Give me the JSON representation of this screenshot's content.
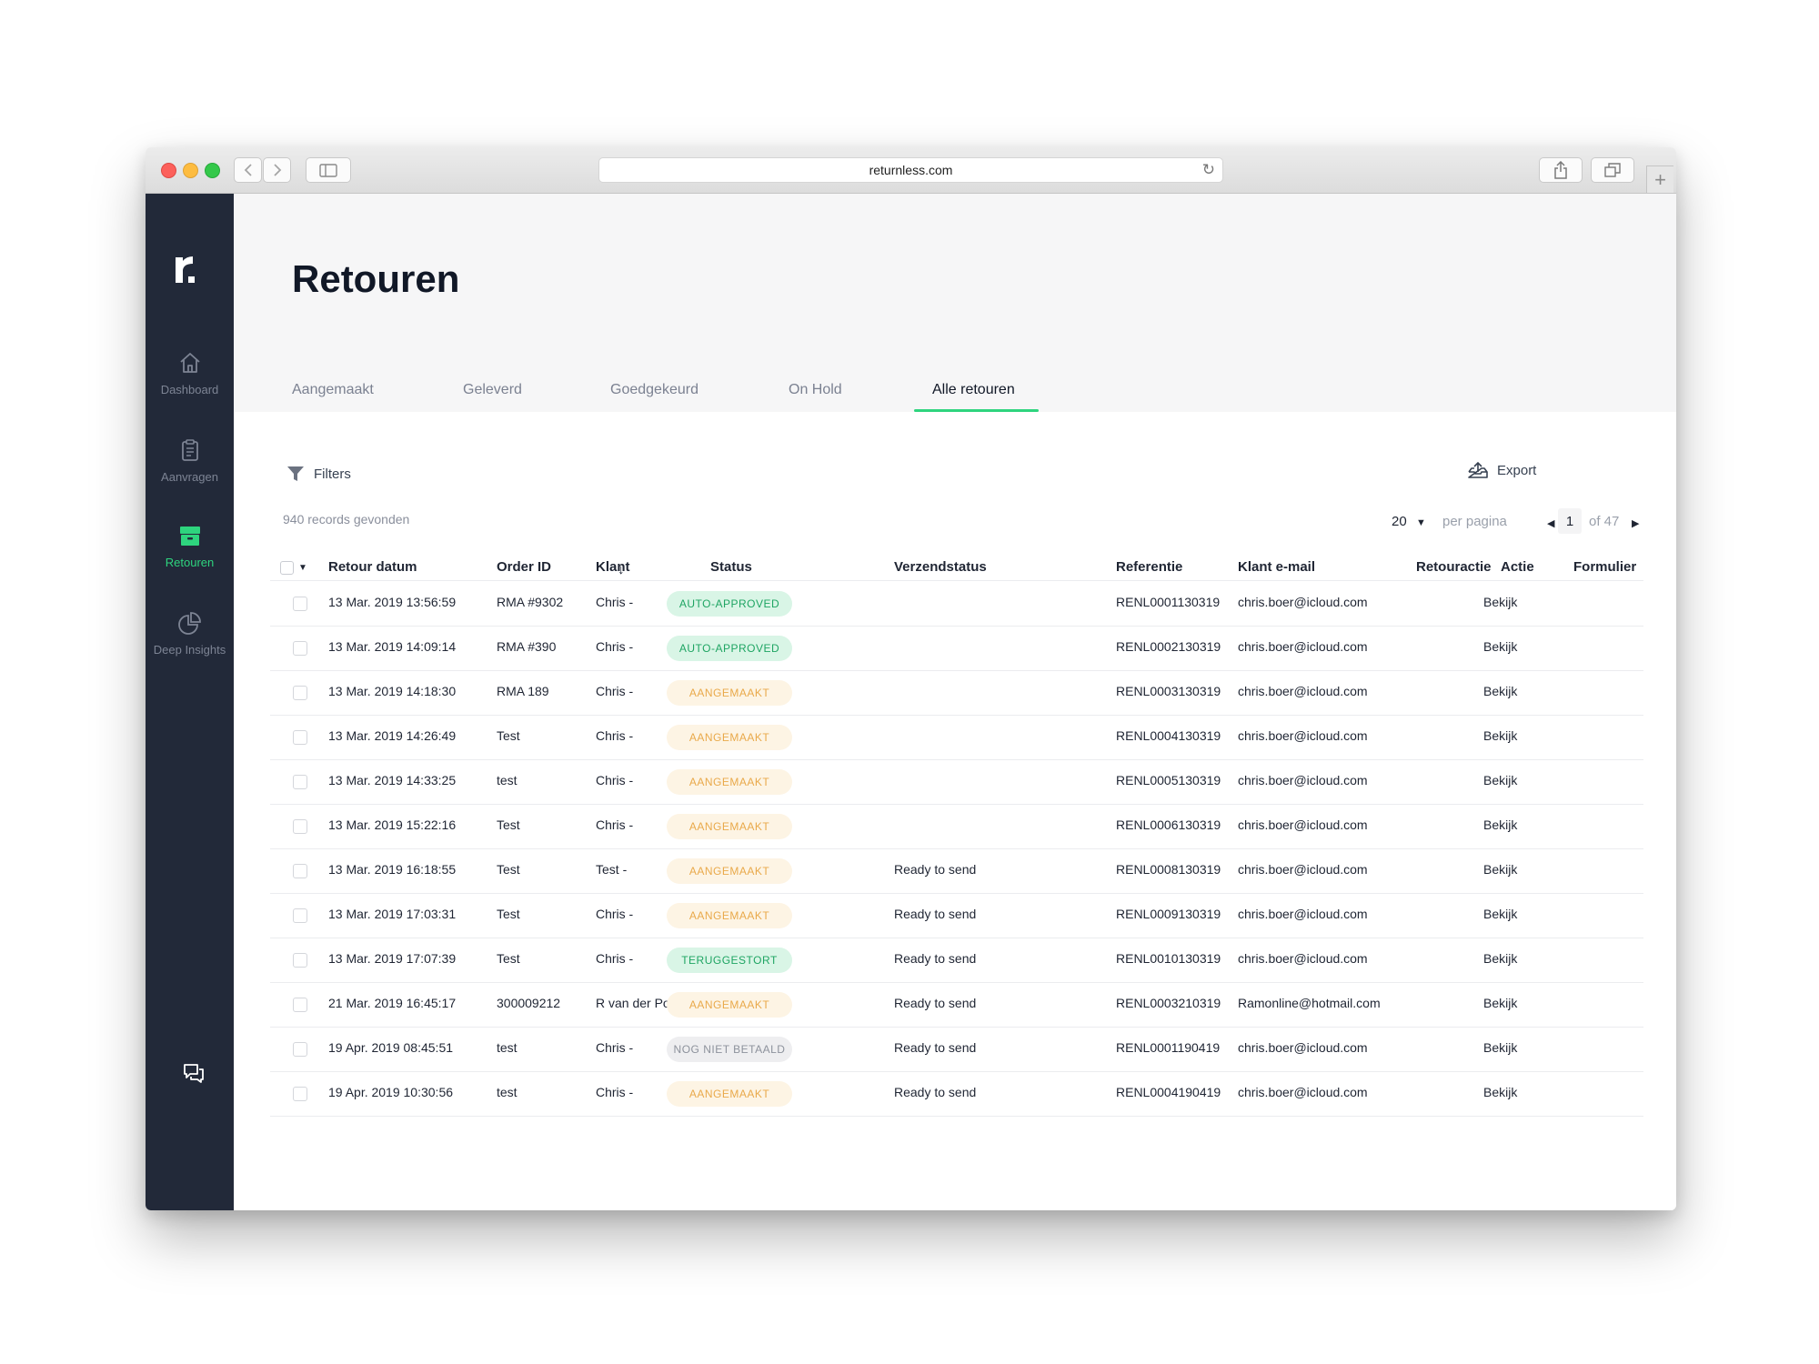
{
  "browser": {
    "url": "returnless.com"
  },
  "sidebar": {
    "logo_text": "r.",
    "items": [
      {
        "label": "Dashboard",
        "icon": "home-icon"
      },
      {
        "label": "Aanvragen",
        "icon": "clipboard-icon"
      },
      {
        "label": "Retouren",
        "icon": "box-icon",
        "active": true
      },
      {
        "label": "Deep Insights",
        "icon": "pie-chart-icon"
      }
    ],
    "chat_icon": "chat-icon"
  },
  "page": {
    "title": "Retouren",
    "tabs": [
      {
        "label": "Aangemaakt"
      },
      {
        "label": "Geleverd"
      },
      {
        "label": "Goedgekeurd"
      },
      {
        "label": "On Hold"
      },
      {
        "label": "Alle retouren",
        "active": true
      }
    ],
    "filters_label": "Filters",
    "export_label": "Export",
    "records_found": "940 records gevonden",
    "per_page_value": "20",
    "per_page_label": "per pagina",
    "current_page": "1",
    "page_total": "of 47"
  },
  "table": {
    "columns": {
      "date": "Retour datum",
      "order": "Order ID",
      "customer": "Klant",
      "status": "Status",
      "shipping": "Verzendstatus",
      "reference": "Referentie",
      "email": "Klant e-mail",
      "return_action": "Retouractie",
      "action": "Actie",
      "form": "Formulier"
    },
    "rows": [
      {
        "date": "13 Mar. 2019 13:56:59",
        "order": "RMA #9302",
        "customer": "Chris -",
        "status": "AUTO-APPROVED",
        "status_type": "green",
        "shipping": "",
        "reference": "RENL0001130319",
        "email": "chris.boer@icloud.com",
        "action": "Bekijk"
      },
      {
        "date": "13 Mar. 2019 14:09:14",
        "order": "RMA #390",
        "customer": "Chris -",
        "status": "AUTO-APPROVED",
        "status_type": "green",
        "shipping": "",
        "reference": "RENL0002130319",
        "email": "chris.boer@icloud.com",
        "action": "Bekijk"
      },
      {
        "date": "13 Mar. 2019 14:18:30",
        "order": "RMA 189",
        "customer": "Chris -",
        "status": "AANGEMAAKT",
        "status_type": "orange",
        "shipping": "",
        "reference": "RENL0003130319",
        "email": "chris.boer@icloud.com",
        "action": "Bekijk"
      },
      {
        "date": "13 Mar. 2019 14:26:49",
        "order": "Test",
        "customer": "Chris -",
        "status": "AANGEMAAKT",
        "status_type": "orange",
        "shipping": "",
        "reference": "RENL0004130319",
        "email": "chris.boer@icloud.com",
        "action": "Bekijk"
      },
      {
        "date": "13 Mar. 2019 14:33:25",
        "order": "test",
        "customer": "Chris -",
        "status": "AANGEMAAKT",
        "status_type": "orange",
        "shipping": "",
        "reference": "RENL0005130319",
        "email": "chris.boer@icloud.com",
        "action": "Bekijk"
      },
      {
        "date": "13 Mar. 2019 15:22:16",
        "order": "Test",
        "customer": "Chris -",
        "status": "AANGEMAAKT",
        "status_type": "orange",
        "shipping": "",
        "reference": "RENL0006130319",
        "email": "chris.boer@icloud.com",
        "action": "Bekijk"
      },
      {
        "date": "13 Mar. 2019 16:18:55",
        "order": "Test",
        "customer": "Test -",
        "status": "AANGEMAAKT",
        "status_type": "orange",
        "shipping": "Ready to send",
        "reference": "RENL0008130319",
        "email": "chris.boer@icloud.com",
        "action": "Bekijk"
      },
      {
        "date": "13 Mar. 2019 17:03:31",
        "order": "Test",
        "customer": "Chris -",
        "status": "AANGEMAAKT",
        "status_type": "orange",
        "shipping": "Ready to send",
        "reference": "RENL0009130319",
        "email": "chris.boer@icloud.com",
        "action": "Bekijk"
      },
      {
        "date": "13 Mar. 2019 17:07:39",
        "order": "Test",
        "customer": "Chris -",
        "status": "TERUGGESTORT",
        "status_type": "green",
        "shipping": "Ready to send",
        "reference": "RENL0010130319",
        "email": "chris.boer@icloud.com",
        "action": "Bekijk"
      },
      {
        "date": "21 Mar. 2019 16:45:17",
        "order": "300009212",
        "customer": "R van der Poel -",
        "status": "AANGEMAAKT",
        "status_type": "orange",
        "shipping": "Ready to send",
        "reference": "RENL0003210319",
        "email": "Ramonline@hotmail.com",
        "action": "Bekijk"
      },
      {
        "date": "19 Apr. 2019 08:45:51",
        "order": "test",
        "customer": "Chris -",
        "status": "NOG NIET BETAALD",
        "status_type": "gray",
        "shipping": "Ready to send",
        "reference": "RENL0001190419",
        "email": "chris.boer@icloud.com",
        "action": "Bekijk"
      },
      {
        "date": "19 Apr. 2019 10:30:56",
        "order": "test",
        "customer": "Chris -",
        "status": "AANGEMAAKT",
        "status_type": "orange",
        "shipping": "Ready to send",
        "reference": "RENL0004190419",
        "email": "chris.boer@icloud.com",
        "action": "Bekijk"
      }
    ]
  },
  "colors": {
    "sidebar_bg": "#222939",
    "accent": "#2ed47e",
    "badge_green": "#1fa563",
    "badge_orange": "#e9a94a",
    "badge_gray": "#8d929c"
  }
}
